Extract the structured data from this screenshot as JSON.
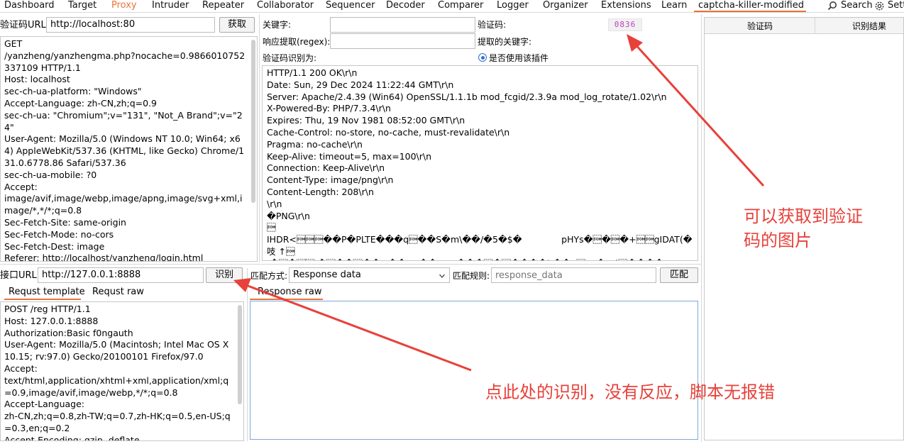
{
  "tabs": [
    "Dashboard",
    "Target",
    "Proxy",
    "Intruder",
    "Repeater",
    "Collaborator",
    "Sequencer",
    "Decoder",
    "Comparer",
    "Logger",
    "Organizer",
    "Extensions",
    "Learn",
    "captcha-killer-modified"
  ],
  "search_label": "Search",
  "settings_label": "Sett",
  "captcha_url": {
    "label": "验证码URL:",
    "value": "http://localhost:80",
    "button": "获取"
  },
  "captcha_request": "GET\n/yanzheng/yanzhengma.php?nocache=0.9866010752337109 HTTP/1.1\nHost: localhost\nsec-ch-ua-platform: \"Windows\"\nAccept-Language: zh-CN,zh;q=0.9\nsec-ch-ua: \"Chromium\";v=\"131\", \"Not_A Brand\";v=\"24\"\nUser-Agent: Mozilla/5.0 (Windows NT 10.0; Win64; x64) AppleWebKit/537.36 (KHTML, like Gecko) Chrome/131.0.6778.86 Safari/537.36\nsec-ch-ua-mobile: ?0\nAccept:\nimage/avif,image/webp,image/apng,image/svg+xml,image/*,*/*;q=0.8\nSec-Fetch-Site: same-origin\nSec-Fetch-Mode: no-cors\nSec-Fetch-Dest: image\nReferer: http://localhost/yanzheng/login.html\nAccept-Encoding: gzip, deflate, br",
  "keyword": {
    "label": "关键字:",
    "value": ""
  },
  "captcha_label": "验证码:",
  "captcha_value": "0836",
  "regex": {
    "label": "响应提取(regex):",
    "value": ""
  },
  "extracted_keyword_label": "提取的关键字:",
  "captcha_recognized_label": "验证码识别为:",
  "use_plugin_label": "是否使用该插件",
  "captcha_response": "HTTP/1.1 200 OK\\r\\n\nDate: Sun, 29 Dec 2024 11:22:44 GMT\\r\\n\nServer: Apache/2.4.39 (Win64) OpenSSL/1.1.1b mod_fcgid/2.3.9a mod_log_rotate/1.02\\r\\n\nX-Powered-By: PHP/7.3.4\\r\\n\nExpires: Thu, 19 Nov 1981 08:52:00 GMT\\r\\n\nCache-Control: no-store, no-cache, must-revalidate\\r\\n\nPragma: no-cache\\r\\n\nKeep-Alive: timeout=5, max=100\\r\\n\nConnection: Keep-Alive\\r\\n\nContent-Type: image/png\\r\\n\nContent-Length: 208\\r\\n\n\\r\\n\n�PNG\\r\\n\n\u0001\nIHDR<\u0001\u0001\u0001��P�PLTE���q\u0001��S�m\\��/�5�$�              pHYs�\u0001�\u0001�+\u0001\u0001gIDAT(�吱 ↑\u0001\n/�\u0001�\u0001\u0001 �\u0001��\u0001��<��>y��s~~���\u0001�\u0001����b��u\u0001*t/�#{\u0001���� \u0001F\u0001�U1]}�3\u0001\nэ��+�dO[�\u0001�_M�??��[>�\u0001�\u0001↑E#���IEND�B`�",
  "right_table": {
    "col1": "验证码",
    "col2": "识别结果"
  },
  "interface_url": {
    "label": "接口URL:",
    "value": "http://127.0.0.1:8888",
    "button": "识别"
  },
  "req_tabs": [
    "Requst template",
    "Requst raw"
  ],
  "req_template": "POST /reg HTTP/1.1\nHost: 127.0.0.1:8888\nAuthorization:Basic f0ngauth\nUser-Agent: Mozilla/5.0 (Macintosh; Intel Mac OS X 10.15; rv:97.0) Gecko/20100101 Firefox/97.0\nAccept:\ntext/html,application/xhtml+xml,application/xml;q=0.9,image/avif,image/webp,*/*;q=0.8\nAccept-Language:\nzh-CN,zh;q=0.8,zh-TW;q=0.7,zh-HK;q=0.5,en-US;q=0.3,en;q=0.2\nAccept-Encoding: gzip, deflate",
  "match": {
    "label": "匹配方式:",
    "value": "Response data",
    "rule_label": "匹配规则:",
    "rule_placeholder": "response_data",
    "button": "匹配"
  },
  "response_raw_tab": "Response raw",
  "annotation1": "可以获取到验证\n码的图片",
  "annotation2": "点此处的识别，没有反应，脚本无报错",
  "colors": {
    "accent": "#e8743b",
    "annotation": "#e8413a",
    "captcha": "#c040c0"
  }
}
